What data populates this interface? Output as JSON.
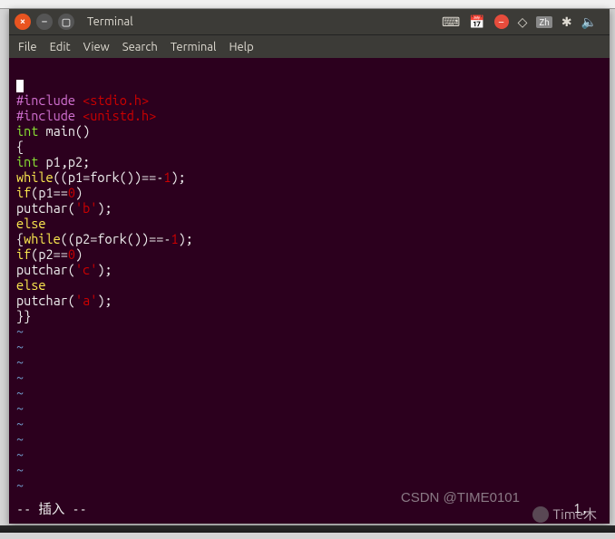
{
  "titlebar": {
    "title": "Terminal"
  },
  "menubar": {
    "file": "File",
    "edit": "Edit",
    "view": "View",
    "search": "Search",
    "terminal": "Terminal",
    "help": "Help"
  },
  "tray": {
    "zh": "Zh"
  },
  "code": {
    "l1a": "#include",
    "l1b": " <stdio.h>",
    "l2a": "#include",
    "l2b": " <unistd.h>",
    "l3a": "int",
    "l3b": " main()",
    "l4": "{",
    "l5a": "int",
    "l5b": " p1,p2;",
    "l6a": "while",
    "l6b": "((p1=fork())==-",
    "l6c": "1",
    "l6d": ");",
    "l7a": "if",
    "l7b": "(p1==",
    "l7c": "0",
    "l7d": ")",
    "l8a": "putchar(",
    "l8b": "'b'",
    "l8c": ");",
    "l9": "else",
    "l10a": "{",
    "l10b": "while",
    "l10c": "((p2=fork())==-",
    "l10d": "1",
    "l10e": ");",
    "l11a": "if",
    "l11b": "(p2==",
    "l11c": "0",
    "l11d": ")",
    "l12a": "putchar(",
    "l12b": "'c'",
    "l12c": ");",
    "l13": "else",
    "l14a": "putchar(",
    "l14b": "'a'",
    "l14c": ");",
    "l15": "}}",
    "tilde": "~"
  },
  "status": {
    "mode": "-- 插入 --",
    "pos": "1,"
  },
  "watermark": {
    "w1": "CSDN @TIME0101",
    "w2": "Time木"
  }
}
